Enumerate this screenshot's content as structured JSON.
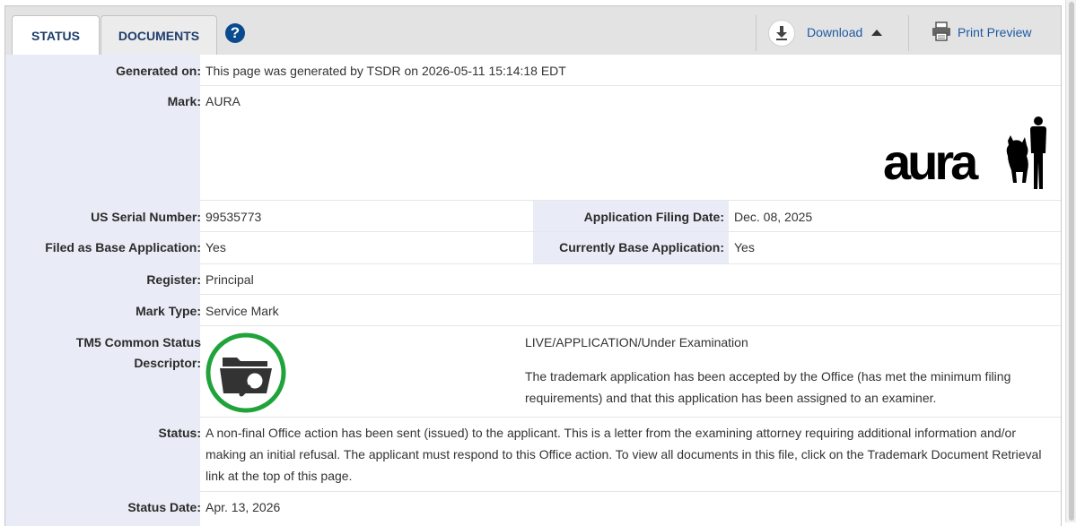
{
  "tabs": [
    {
      "label": "STATUS",
      "active": true
    },
    {
      "label": "DOCUMENTS",
      "active": false
    }
  ],
  "toolbar": {
    "help_symbol": "?",
    "download_label": "Download",
    "print_label": "Print Preview"
  },
  "fields": {
    "generated_on": {
      "label": "Generated on:",
      "value": "This page was generated by TSDR on 2026-05-11 15:14:18 EDT"
    },
    "mark": {
      "label": "Mark:",
      "value": "AURA",
      "image_text": "aura"
    },
    "serial": {
      "label": "US Serial Number:",
      "value": "99535773"
    },
    "filing_date": {
      "label": "Application Filing Date:",
      "value": "Dec. 08, 2025"
    },
    "filed_base": {
      "label": "Filed as Base Application:",
      "value": "Yes"
    },
    "current_base": {
      "label": "Currently Base Application:",
      "value": "Yes"
    },
    "register": {
      "label": "Register:",
      "value": "Principal"
    },
    "mark_type": {
      "label": "Mark Type:",
      "value": "Service Mark"
    },
    "tm5": {
      "label_line1": "TM5 Common Status",
      "label_line2": "Descriptor:",
      "title": "LIVE/APPLICATION/Under Examination",
      "description": "The trademark application has been accepted by the Office (has met the minimum filing requirements) and that this application has been assigned to an examiner."
    },
    "status": {
      "label": "Status:",
      "value": "A non-final Office action has been sent (issued) to the applicant. This is a letter from the examining attorney requiring additional information and/or making an initial refusal. The applicant must respond to this Office action. To view all documents in this file, click on the Trademark Document Retrieval link at the top of this page."
    },
    "status_date": {
      "label": "Status Date:",
      "value": "Apr. 13, 2026"
    }
  },
  "colors": {
    "tm5_ring": "#1fa33a",
    "link": "#1d5aa5",
    "label_bg": "#e9ecf6"
  }
}
